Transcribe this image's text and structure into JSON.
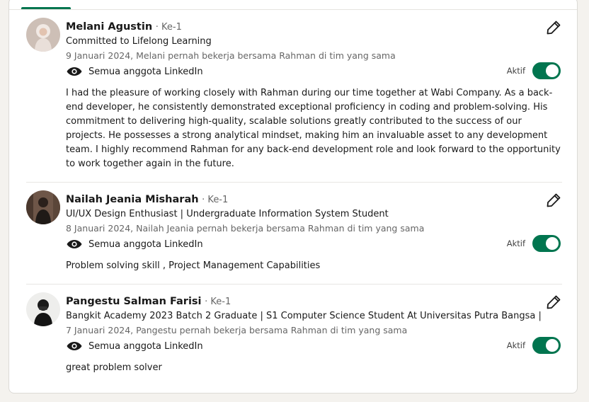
{
  "colors": {
    "accent": "#01754f",
    "text": "#191919",
    "muted": "#666666"
  },
  "recommendations": [
    {
      "name": "Melani Agustin",
      "degree": "· Ke-1",
      "headline": "Committed to Lifelong Learning",
      "meta": "9 Januari 2024, Melani pernah bekerja bersama Rahman di tim yang sama",
      "visibility": "Semua anggota LinkedIn",
      "toggle_label": "Aktif",
      "toggle_on": true,
      "text": "I had the pleasure of working closely with Rahman during our time together at Wabi Company. As a back-end developer, he consistently demonstrated exceptional proficiency in coding and problem-solving. His commitment to delivering high-quality, scalable solutions greatly contributed to the success of our projects. He possesses a strong analytical mindset, making him an invaluable asset to any development team. I highly recommend Rahman for any back-end development role and look forward to the opportunity to work together again in the future."
    },
    {
      "name": "Nailah Jeania Misharah",
      "degree": "· Ke-1",
      "headline": "UI/UX Design Enthusiast | Undergraduate Information System Student",
      "meta": "8 Januari 2024, Nailah Jeania pernah bekerja bersama Rahman di tim yang sama",
      "visibility": "Semua anggota LinkedIn",
      "toggle_label": "Aktif",
      "toggle_on": true,
      "text": "Problem solving skill , Project Management Capabilities"
    },
    {
      "name": "Pangestu Salman Farisi",
      "degree": "· Ke-1",
      "headline": "Bangkit Academy 2023 Batch 2 Graduate | S1 Computer Science Student At Universitas Putra Bangsa |",
      "meta": "7 Januari 2024, Pangestu pernah bekerja bersama Rahman di tim yang sama",
      "visibility": "Semua anggota LinkedIn",
      "toggle_label": "Aktif",
      "toggle_on": true,
      "text": "great problem solver"
    }
  ]
}
